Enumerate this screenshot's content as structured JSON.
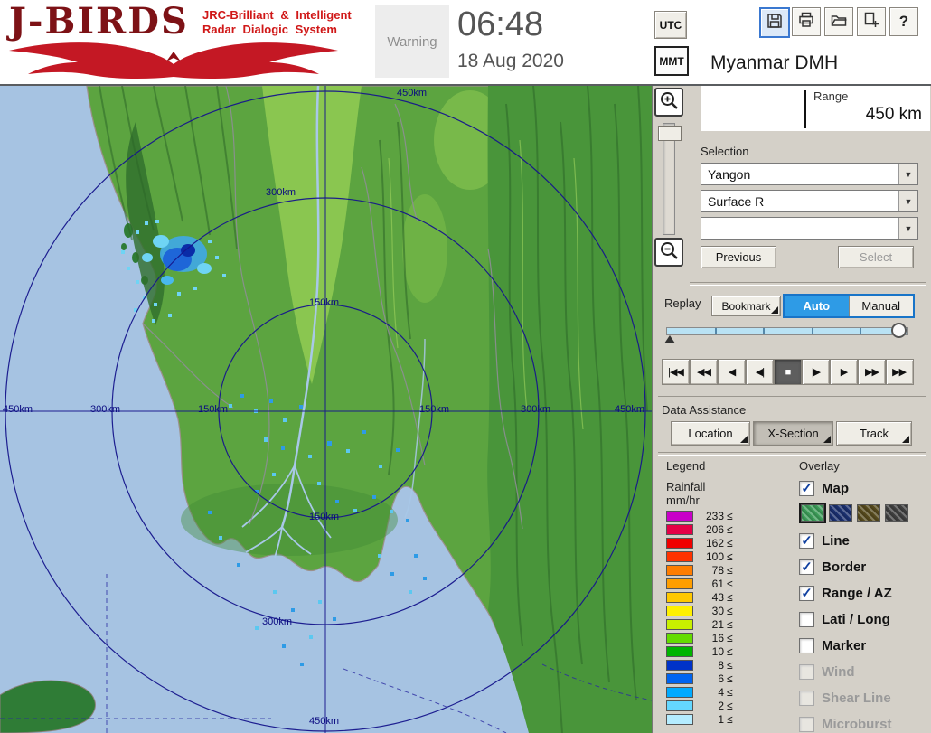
{
  "header": {
    "logo_title": "J-BIRDS",
    "logo_subtitle1": "JRC-Brilliant & Intelligent",
    "logo_subtitle2": "Radar Dialogic System",
    "warning_label": "Warning",
    "time": "06:48",
    "date": "18 Aug 2020",
    "utc_label": "UTC",
    "mmt_label": "MMT",
    "selected_timezone": "MMT",
    "help_label": "?",
    "station_title": "Myanmar DMH"
  },
  "range_panel": {
    "label": "Range",
    "value": "450 km"
  },
  "selection": {
    "label": "Selection",
    "site": "Yangon",
    "product": "Surface R",
    "extra": "",
    "previous_label": "Previous",
    "select_label": "Select"
  },
  "replay": {
    "label": "Replay",
    "bookmark_label": "Bookmark",
    "auto_label": "Auto",
    "manual_label": "Manual",
    "playback_buttons": [
      "|◀◀",
      "◀◀",
      "◀",
      "◀|",
      "■",
      "|▶",
      "▶",
      "▶▶",
      "▶▶|"
    ]
  },
  "data_assistance": {
    "label": "Data Assistance",
    "buttons": [
      "Location",
      "X-Section",
      "Track"
    ]
  },
  "legend": {
    "label": "Legend",
    "title_line1": "Rainfall",
    "title_line2": "mm/hr",
    "le_symbol": "≤",
    "rows": [
      {
        "value": "233",
        "color": "#C800C8"
      },
      {
        "value": "206",
        "color": "#E40046"
      },
      {
        "value": "162",
        "color": "#F00000"
      },
      {
        "value": "100",
        "color": "#FF3200"
      },
      {
        "value": "78",
        "color": "#FF7D00"
      },
      {
        "value": "61",
        "color": "#FF9E00"
      },
      {
        "value": "43",
        "color": "#FFC800"
      },
      {
        "value": "30",
        "color": "#FFF000"
      },
      {
        "value": "21",
        "color": "#C8F000"
      },
      {
        "value": "16",
        "color": "#64DC00"
      },
      {
        "value": "10",
        "color": "#00B400"
      },
      {
        "value": "8",
        "color": "#0032C8"
      },
      {
        "value": "6",
        "color": "#0064F0"
      },
      {
        "value": "4",
        "color": "#00AAFF"
      },
      {
        "value": "2",
        "color": "#64D7FF"
      },
      {
        "value": "1",
        "color": "#B4ECFF"
      }
    ]
  },
  "overlay": {
    "label": "Overlay",
    "map_styles": [
      "#3C9B58",
      "#1A2F6E",
      "#55491C",
      "#3F3F3F"
    ],
    "items": [
      {
        "label": "Map",
        "mark": "✓",
        "enabled": true
      },
      {
        "label": "Line",
        "mark": "✓",
        "enabled": true
      },
      {
        "label": "Border",
        "mark": "✓",
        "enabled": true
      },
      {
        "label": "Range / AZ",
        "mark": "✓",
        "enabled": true
      },
      {
        "label": "Lati / Long",
        "mark": "",
        "enabled": true
      },
      {
        "label": "Marker",
        "mark": "",
        "enabled": true
      },
      {
        "label": "Wind",
        "mark": "",
        "enabled": false
      },
      {
        "label": "Shear Line",
        "mark": "",
        "enabled": false
      },
      {
        "label": "Microburst",
        "mark": "",
        "enabled": false
      }
    ]
  },
  "map": {
    "ring_labels": [
      "450km",
      "300km",
      "150km",
      "450km",
      "300km",
      "150km",
      "150km",
      "300km",
      "450km",
      "150km",
      "300km",
      "450km"
    ]
  }
}
